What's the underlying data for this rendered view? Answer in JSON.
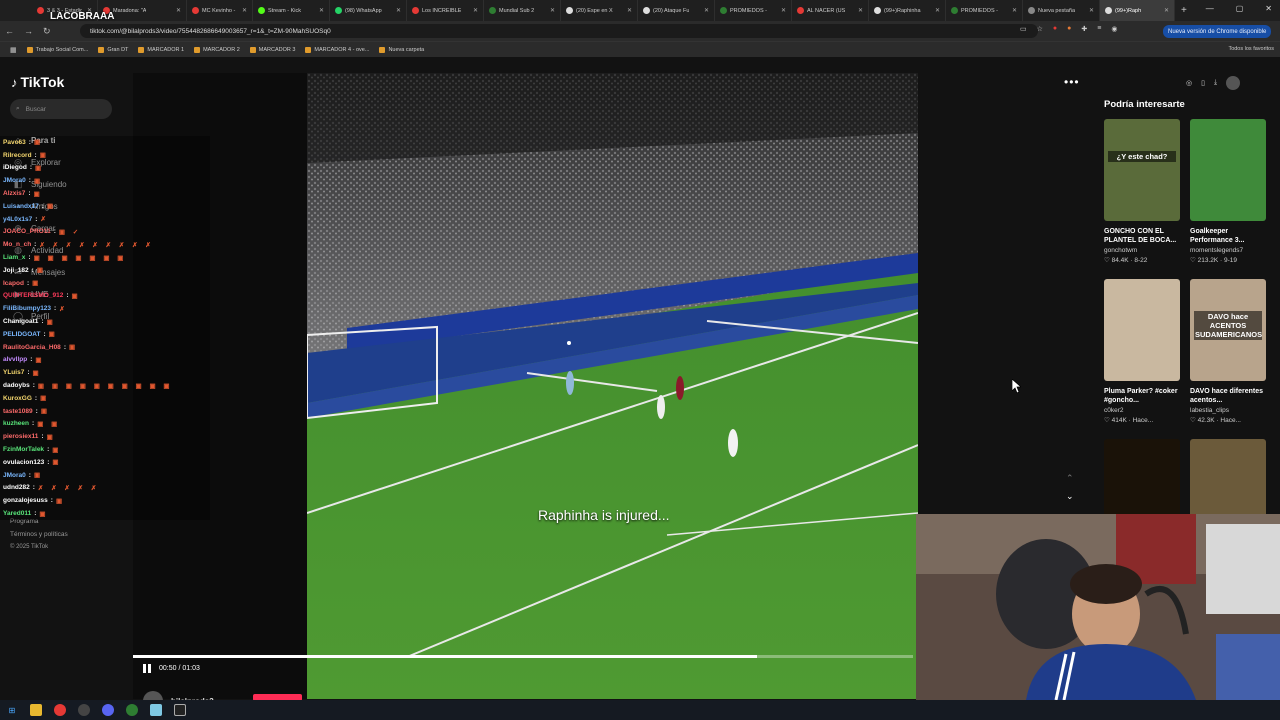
{
  "browser": {
    "tabs": [
      {
        "label": "3 & 3 - Estadio",
        "color": "#e53935"
      },
      {
        "label": "Maradona: \"A",
        "color": "#e53935"
      },
      {
        "label": "MC Kevinho - C",
        "color": "#e53935"
      },
      {
        "label": "Stream - Kick",
        "color": "#53fc18"
      },
      {
        "label": "(98) WhatsApp",
        "color": "#25d366"
      },
      {
        "label": "Los INCREIBLE",
        "color": "#e53935"
      },
      {
        "label": "Mundial Sub 2",
        "color": "#2e7d32"
      },
      {
        "label": "(20) Espe en X",
        "color": "#dddddd"
      },
      {
        "label": "(20) Ataque Fu",
        "color": "#dddddd"
      },
      {
        "label": "PROMIEDOS -",
        "color": "#2e7d32"
      },
      {
        "label": "AL NACER (US",
        "color": "#e53935"
      },
      {
        "label": "(99+)Raphinha",
        "color": "#dddddd"
      },
      {
        "label": "PROMIEDOS -",
        "color": "#2e7d32"
      },
      {
        "label": "Nueva pestaña",
        "color": "#888888"
      },
      {
        "label": "(99+)Raph",
        "color": "#dddddd"
      }
    ],
    "overlay_name": "LACOBRAAA",
    "url": "tiktok.com/@bilalprods3/video/7554482686649003657_r=1&_t=ZM-90MahSUOSq0",
    "update_label": "Nueva versión de Chrome disponible",
    "bookmarks": [
      "Trabajo Social Com...",
      "Gran DT",
      "MARCADOR 1",
      "MARCADOR 2",
      "MARCADOR 3",
      "MARCADOR 4 - ove...",
      "Nueva carpeta"
    ],
    "all_bookmarks": "Todos los favoritos"
  },
  "tiktok": {
    "logo": "TikTok",
    "search_placeholder": "Buscar",
    "nav": [
      "Para ti",
      "Explorar",
      "Siguiendo",
      "Amigos",
      "Cargar",
      "Actividad",
      "Mensajes",
      "LIVE",
      "Perfil"
    ],
    "footer": [
      "Programa",
      "Términos y políticas",
      "© 2025 TikTok"
    ],
    "caption": "Raphinha is injured...",
    "time": "00:50 / 01:03",
    "progress": 0.8,
    "author": "bilalprods3",
    "related_title": "Podría interesarte",
    "cards": [
      {
        "title": "GONCHO CON EL PLANTEL DE BOCA...",
        "author": "gonchotwm",
        "stats": "♡ 84.4K · 8-22",
        "bg": "#5a6b3a",
        "overlay": "¿Y este chad?"
      },
      {
        "title": "Goalkeeper Performance 3...",
        "author": "momentslegends7",
        "stats": "♡ 213.2K · 9-19",
        "bg": "#3f8a3a",
        "overlay": ""
      },
      {
        "title": "Pluma Parker? #coker #goncho...",
        "author": "c0ker2",
        "stats": "♡ 414K · Hace...",
        "bg": "#c9b8a0",
        "overlay": ""
      },
      {
        "title": "DAVO hace diferentes acentos...",
        "author": "labestia_clips",
        "stats": "♡ 42.3K · Hace...",
        "bg": "#b8a48c",
        "overlay": "DAVO hace ACENTOS SUDAMERICANOS"
      },
      {
        "title": "",
        "author": "",
        "stats": "",
        "bg": "#1a1208",
        "overlay": ""
      },
      {
        "title": "",
        "author": "",
        "stats": "",
        "bg": "#6b5a3a",
        "overlay": ""
      }
    ]
  },
  "chat": [
    {
      "user": "Pavo63",
      "color": "#f5d76e",
      "emotes": "▣"
    },
    {
      "user": "Rilrecord",
      "color": "#f5d76e",
      "emotes": "▣"
    },
    {
      "user": "iDiegod",
      "color": "#ffffff",
      "emotes": "▣"
    },
    {
      "user": "JMora0",
      "color": "#7ab8ff",
      "emotes": "▣"
    },
    {
      "user": "Alzxis7",
      "color": "#ff6b6b",
      "emotes": "▣"
    },
    {
      "user": "Luisandx17",
      "color": "#7ab8ff",
      "emotes": "▣"
    },
    {
      "user": "y4L0x1s7",
      "color": "#7ab8ff",
      "emotes": "✗"
    },
    {
      "user": "JOACO_PRO11",
      "color": "#ff6b6b",
      "emotes": "▣ ✓"
    },
    {
      "user": "Mo_n_ch",
      "color": "#ff6b6b",
      "emotes": "✗ ✗ ✗ ✗ ✗ ✗ ✗ ✗ ✗"
    },
    {
      "user": "Liam_x",
      "color": "#59e67a",
      "emotes": "▣ ▣ ▣ ▣ ▣ ▣ ▣"
    },
    {
      "user": "Joji_182",
      "color": "#ffffff",
      "emotes": "▣"
    },
    {
      "user": "Icapod",
      "color": "#ff6b6b",
      "emotes": "▣"
    },
    {
      "user": "QUINTERISMO_912",
      "color": "#ff3b5c",
      "emotes": "▣"
    },
    {
      "user": "FiliBibumpy123",
      "color": "#7ab8ff",
      "emotes": "✗"
    },
    {
      "user": "Chanigoat1",
      "color": "#ffffff",
      "emotes": "▣"
    },
    {
      "user": "PELIDGOAT",
      "color": "#7ab8ff",
      "emotes": "▣"
    },
    {
      "user": "RaulitoGarcia_H08",
      "color": "#ff6b6b",
      "emotes": "▣"
    },
    {
      "user": "alvvllpp",
      "color": "#c48bff",
      "emotes": "▣"
    },
    {
      "user": "YLuis7",
      "color": "#f5d76e",
      "emotes": "▣"
    },
    {
      "user": "dadoybs",
      "color": "#ffffff",
      "emotes": "▣ ▣ ▣ ▣ ▣ ▣ ▣ ▣ ▣ ▣"
    },
    {
      "user": "KuroxGG",
      "color": "#f5d76e",
      "emotes": "▣"
    },
    {
      "user": "taste1089",
      "color": "#ff6b6b",
      "emotes": "▣"
    },
    {
      "user": "kuzheen",
      "color": "#59e67a",
      "emotes": "▣ ▣"
    },
    {
      "user": "pierosiex11",
      "color": "#ff6b6b",
      "emotes": "▣"
    },
    {
      "user": "FzinMorTalek",
      "color": "#59e67a",
      "emotes": "▣"
    },
    {
      "user": "ovulacion123",
      "color": "#ffffff",
      "emotes": "▣"
    },
    {
      "user": "JMora0",
      "color": "#7ab8ff",
      "emotes": "▣"
    },
    {
      "user": "udnd282",
      "color": "#ffffff",
      "emotes": "✗ ✗ ✗ ✗ ✗"
    },
    {
      "user": "gonzalojesuss",
      "color": "#ffffff",
      "emotes": "▣"
    },
    {
      "user": "Yared011",
      "color": "#59e67a",
      "emotes": "▣"
    }
  ]
}
